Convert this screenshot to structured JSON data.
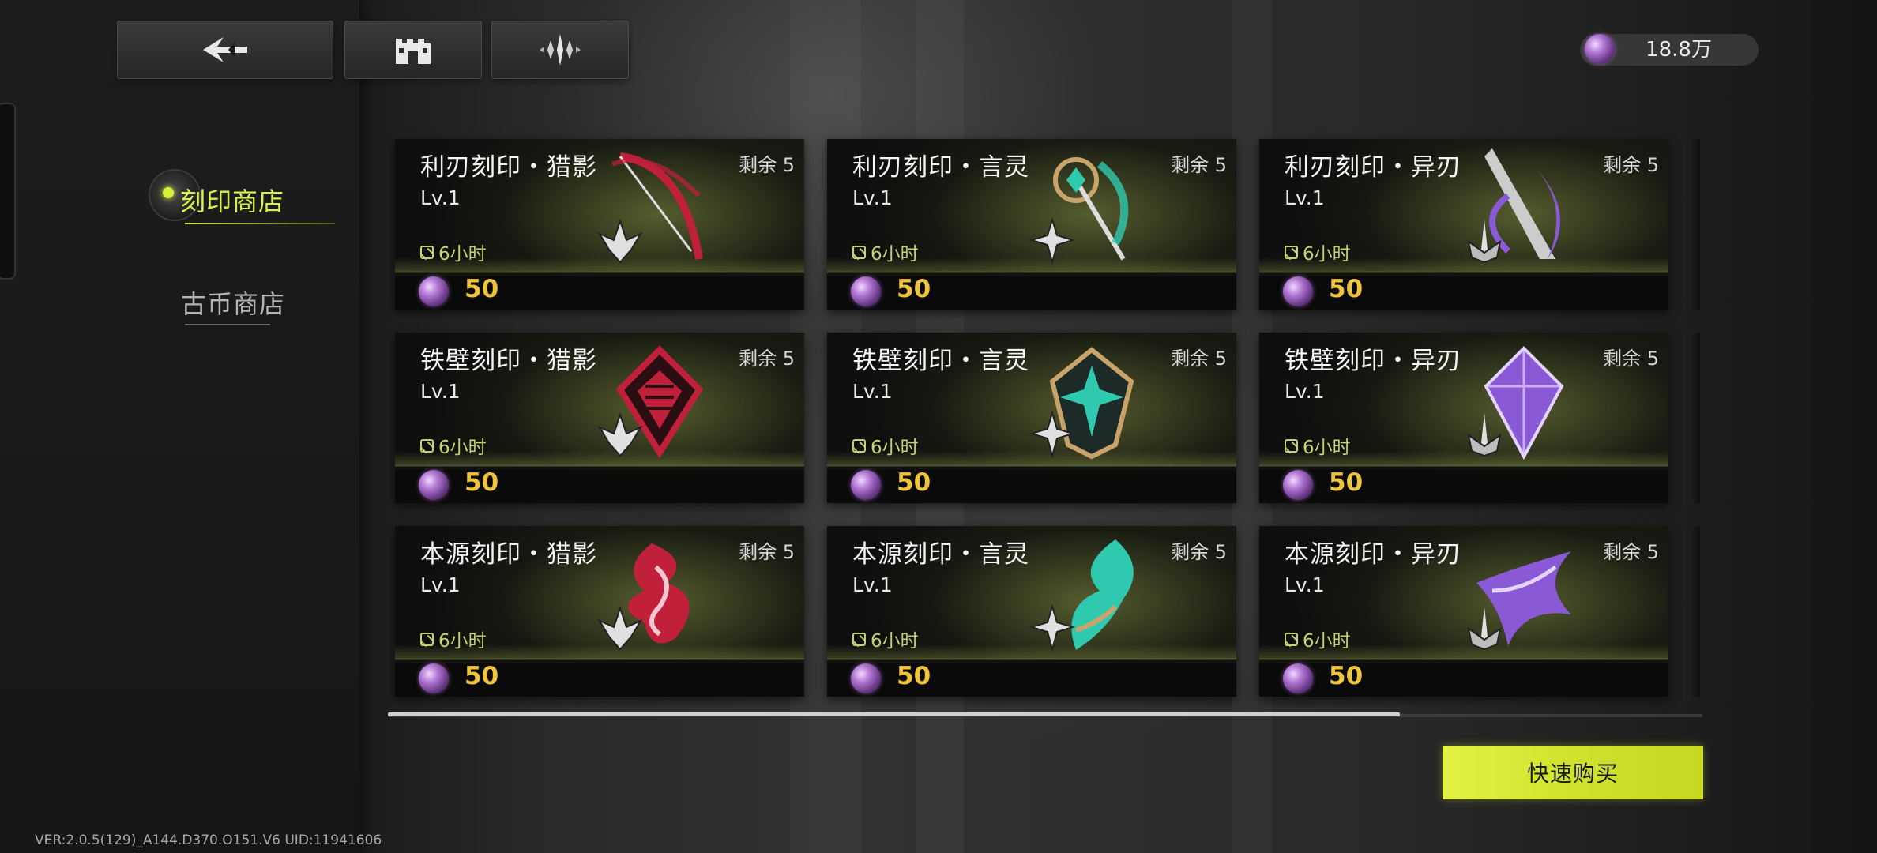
{
  "topbar": {
    "back_label": "back",
    "buttons": [
      {
        "name": "back-button",
        "icon": "arrow-left-icon"
      },
      {
        "name": "castle-button",
        "icon": "castle-icon"
      },
      {
        "name": "crest-button",
        "icon": "crest-icon"
      }
    ],
    "currency": {
      "icon": "orb-currency-icon",
      "amount": "18.8万"
    }
  },
  "sidebar": {
    "items": [
      {
        "label": "刻印商店",
        "active": true
      },
      {
        "label": "古币商店",
        "active": false
      }
    ]
  },
  "shop": {
    "items": [
      {
        "name": "利刃刻印・猎影",
        "level": "Lv.1",
        "stock": "剩余 5",
        "timer": "6小时",
        "price": "50",
        "art": "red-bow-icon",
        "class": "hunter-class-icon",
        "color": "#c0203a"
      },
      {
        "name": "利刃刻印・言灵",
        "level": "Lv.1",
        "stock": "剩余 5",
        "timer": "6小时",
        "price": "50",
        "art": "teal-staff-icon",
        "class": "spirit-class-icon",
        "color": "#2fc9b0"
      },
      {
        "name": "利刃刻印・异刃",
        "level": "Lv.1",
        "stock": "剩余 5",
        "timer": "6小时",
        "price": "50",
        "art": "violet-blade-icon",
        "class": "blade-class-icon",
        "color": "#8a5ad6"
      },
      {
        "name": "铁壁刻印・猎影",
        "level": "Lv.1",
        "stock": "剩余 5",
        "timer": "6小时",
        "price": "50",
        "art": "red-shield-icon",
        "class": "hunter-class-icon",
        "color": "#c0203a"
      },
      {
        "name": "铁壁刻印・言灵",
        "level": "Lv.1",
        "stock": "剩余 5",
        "timer": "6小时",
        "price": "50",
        "art": "teal-shield-icon",
        "class": "spirit-class-icon",
        "color": "#2fc9b0"
      },
      {
        "name": "铁壁刻印・异刃",
        "level": "Lv.1",
        "stock": "剩余 5",
        "timer": "6小时",
        "price": "50",
        "art": "violet-crystal-icon",
        "class": "blade-class-icon",
        "color": "#8a5ad6"
      },
      {
        "name": "本源刻印・猎影",
        "level": "Lv.1",
        "stock": "剩余 5",
        "timer": "6小时",
        "price": "50",
        "art": "red-flame-icon",
        "class": "hunter-class-icon",
        "color": "#c0203a"
      },
      {
        "name": "本源刻印・言灵",
        "level": "Lv.1",
        "stock": "剩余 5",
        "timer": "6小时",
        "price": "50",
        "art": "teal-wisp-icon",
        "class": "spirit-class-icon",
        "color": "#2fc9b0"
      },
      {
        "name": "本源刻印・异刃",
        "level": "Lv.1",
        "stock": "剩余 5",
        "timer": "6小时",
        "price": "50",
        "art": "violet-spike-icon",
        "class": "blade-class-icon",
        "color": "#8a5ad6"
      }
    ],
    "scroll_progress": 0.77
  },
  "actions": {
    "quick_buy": "快速购买"
  },
  "footer": {
    "version": "VER:2.0.5(129)_A144.D370.O151.V6    UID:11941606"
  }
}
